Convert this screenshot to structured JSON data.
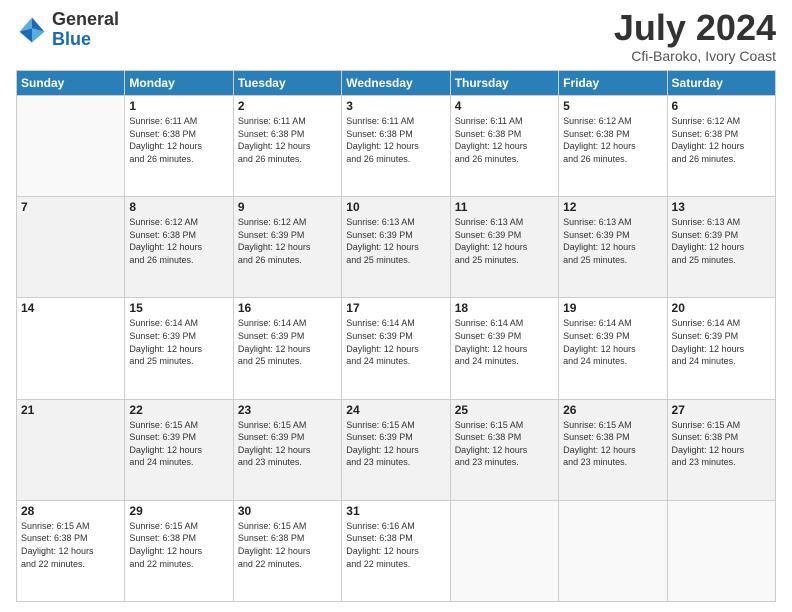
{
  "logo": {
    "general": "General",
    "blue": "Blue"
  },
  "header": {
    "month_year": "July 2024",
    "location": "Cfi-Baroko, Ivory Coast"
  },
  "days_of_week": [
    "Sunday",
    "Monday",
    "Tuesday",
    "Wednesday",
    "Thursday",
    "Friday",
    "Saturday"
  ],
  "weeks": [
    [
      {
        "day": "",
        "info": ""
      },
      {
        "day": "1",
        "info": "Sunrise: 6:11 AM\nSunset: 6:38 PM\nDaylight: 12 hours\nand 26 minutes."
      },
      {
        "day": "2",
        "info": "Sunrise: 6:11 AM\nSunset: 6:38 PM\nDaylight: 12 hours\nand 26 minutes."
      },
      {
        "day": "3",
        "info": "Sunrise: 6:11 AM\nSunset: 6:38 PM\nDaylight: 12 hours\nand 26 minutes."
      },
      {
        "day": "4",
        "info": "Sunrise: 6:11 AM\nSunset: 6:38 PM\nDaylight: 12 hours\nand 26 minutes."
      },
      {
        "day": "5",
        "info": "Sunrise: 6:12 AM\nSunset: 6:38 PM\nDaylight: 12 hours\nand 26 minutes."
      },
      {
        "day": "6",
        "info": "Sunrise: 6:12 AM\nSunset: 6:38 PM\nDaylight: 12 hours\nand 26 minutes."
      }
    ],
    [
      {
        "day": "7",
        "info": ""
      },
      {
        "day": "8",
        "info": "Sunrise: 6:12 AM\nSunset: 6:38 PM\nDaylight: 12 hours\nand 26 minutes."
      },
      {
        "day": "9",
        "info": "Sunrise: 6:12 AM\nSunset: 6:39 PM\nDaylight: 12 hours\nand 26 minutes."
      },
      {
        "day": "10",
        "info": "Sunrise: 6:13 AM\nSunset: 6:39 PM\nDaylight: 12 hours\nand 25 minutes."
      },
      {
        "day": "11",
        "info": "Sunrise: 6:13 AM\nSunset: 6:39 PM\nDaylight: 12 hours\nand 25 minutes."
      },
      {
        "day": "12",
        "info": "Sunrise: 6:13 AM\nSunset: 6:39 PM\nDaylight: 12 hours\nand 25 minutes."
      },
      {
        "day": "13",
        "info": "Sunrise: 6:13 AM\nSunset: 6:39 PM\nDaylight: 12 hours\nand 25 minutes."
      }
    ],
    [
      {
        "day": "14",
        "info": ""
      },
      {
        "day": "15",
        "info": "Sunrise: 6:14 AM\nSunset: 6:39 PM\nDaylight: 12 hours\nand 25 minutes."
      },
      {
        "day": "16",
        "info": "Sunrise: 6:14 AM\nSunset: 6:39 PM\nDaylight: 12 hours\nand 25 minutes."
      },
      {
        "day": "17",
        "info": "Sunrise: 6:14 AM\nSunset: 6:39 PM\nDaylight: 12 hours\nand 24 minutes."
      },
      {
        "day": "18",
        "info": "Sunrise: 6:14 AM\nSunset: 6:39 PM\nDaylight: 12 hours\nand 24 minutes."
      },
      {
        "day": "19",
        "info": "Sunrise: 6:14 AM\nSunset: 6:39 PM\nDaylight: 12 hours\nand 24 minutes."
      },
      {
        "day": "20",
        "info": "Sunrise: 6:14 AM\nSunset: 6:39 PM\nDaylight: 12 hours\nand 24 minutes."
      }
    ],
    [
      {
        "day": "21",
        "info": ""
      },
      {
        "day": "22",
        "info": "Sunrise: 6:15 AM\nSunset: 6:39 PM\nDaylight: 12 hours\nand 24 minutes."
      },
      {
        "day": "23",
        "info": "Sunrise: 6:15 AM\nSunset: 6:39 PM\nDaylight: 12 hours\nand 23 minutes."
      },
      {
        "day": "24",
        "info": "Sunrise: 6:15 AM\nSunset: 6:39 PM\nDaylight: 12 hours\nand 23 minutes."
      },
      {
        "day": "25",
        "info": "Sunrise: 6:15 AM\nSunset: 6:38 PM\nDaylight: 12 hours\nand 23 minutes."
      },
      {
        "day": "26",
        "info": "Sunrise: 6:15 AM\nSunset: 6:38 PM\nDaylight: 12 hours\nand 23 minutes."
      },
      {
        "day": "27",
        "info": "Sunrise: 6:15 AM\nSunset: 6:38 PM\nDaylight: 12 hours\nand 23 minutes."
      }
    ],
    [
      {
        "day": "28",
        "info": "Sunrise: 6:15 AM\nSunset: 6:38 PM\nDaylight: 12 hours\nand 22 minutes."
      },
      {
        "day": "29",
        "info": "Sunrise: 6:15 AM\nSunset: 6:38 PM\nDaylight: 12 hours\nand 22 minutes."
      },
      {
        "day": "30",
        "info": "Sunrise: 6:15 AM\nSunset: 6:38 PM\nDaylight: 12 hours\nand 22 minutes."
      },
      {
        "day": "31",
        "info": "Sunrise: 6:16 AM\nSunset: 6:38 PM\nDaylight: 12 hours\nand 22 minutes."
      },
      {
        "day": "",
        "info": ""
      },
      {
        "day": "",
        "info": ""
      },
      {
        "day": "",
        "info": ""
      }
    ]
  ]
}
